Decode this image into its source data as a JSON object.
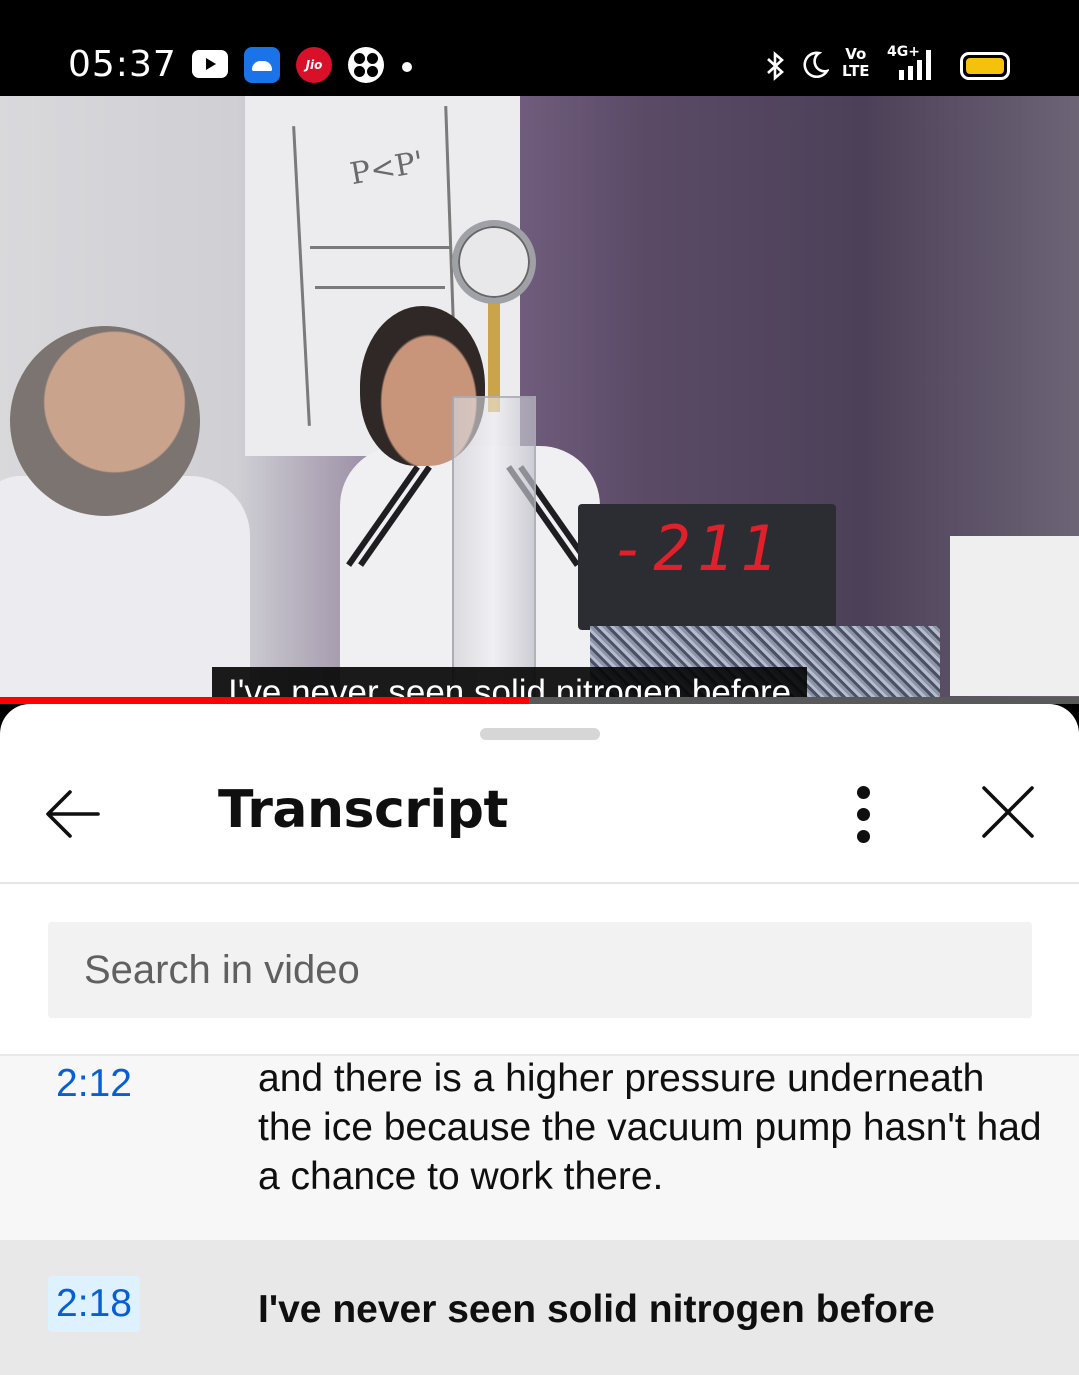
{
  "status_bar": {
    "time": "05:37",
    "icons": [
      "youtube-icon",
      "android-app-icon",
      "jio-icon",
      "fan-app-icon",
      "notification-dot-icon",
      "bluetooth-icon",
      "do-not-disturb-moon-icon",
      "volte-icon",
      "signal-4g-icon",
      "battery-icon"
    ],
    "volte_label_top": "Vo",
    "volte_label_bottom": "LTE",
    "network_label": "4G+",
    "jio_label": "Jio",
    "battery_color": "#f4c20d"
  },
  "video": {
    "caption": "I've never seen solid nitrogen before",
    "display_reading": "-211",
    "whiteboard_text": "P<P'",
    "progress_fraction": 0.49,
    "progress_color": "#ff0000"
  },
  "panel": {
    "title": "Transcript",
    "search_placeholder": "Search in video",
    "segments": [
      {
        "time": "2:12",
        "text": "and there is a higher pressure underneath the ice because the vacuum pump hasn't had a chance to work there.",
        "active": false
      },
      {
        "time": "2:18",
        "text": "I've never seen solid nitrogen before",
        "active": true
      }
    ],
    "accent_color": "#065fd4"
  }
}
